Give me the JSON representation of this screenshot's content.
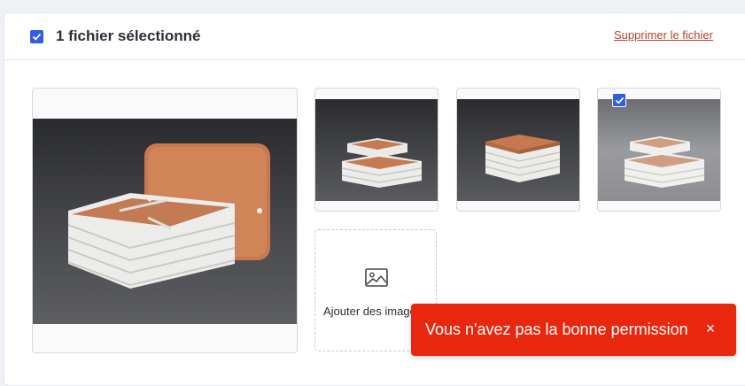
{
  "header": {
    "selection_label": "1 fichier sélectionné",
    "delete_label": "Supprimer le fichier"
  },
  "gallery": {
    "main_image_icon": "storage-box-photo",
    "thumbnails": [
      {
        "icon": "storage-box-open-photo",
        "selected": false
      },
      {
        "icon": "storage-box-closed-photo",
        "selected": false
      },
      {
        "icon": "storage-box-open-grey-photo",
        "selected": true
      }
    ],
    "add_images_label": "Ajouter des images",
    "add_images_icon": "image-icon"
  },
  "toast": {
    "message": "Vous n'avez pas la bonne permission",
    "close_glyph": "×"
  },
  "colors": {
    "accent": "#2f5de6",
    "link": "#b4422b",
    "toast_background": "#e8270e"
  }
}
